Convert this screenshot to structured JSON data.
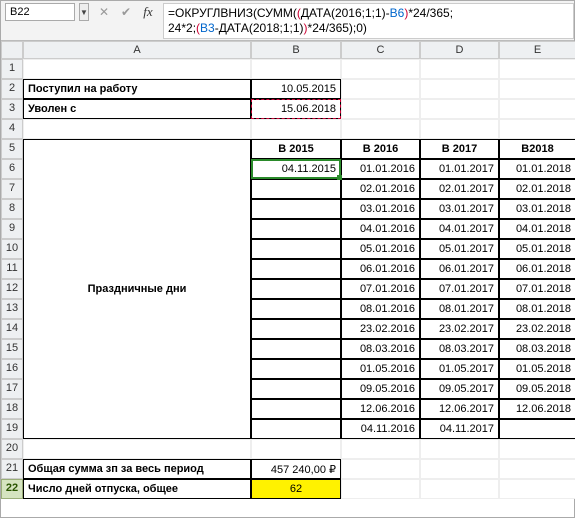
{
  "nameBox": "B22",
  "formula": {
    "part1": "=ОКРУГЛВНИЗ(СУММ(",
    "paren1": "(",
    "part2": "ДАТА(2016;1;1)-",
    "ref1": "B6",
    "paren1b": ")",
    "part3": "*24/365;",
    "break": "\n",
    "part4": "24*2;",
    "paren2": "(",
    "ref2": "B3",
    "part5": "-ДАТА(2018;1;1)",
    "paren2b": ")",
    "part6": "*24/365);0)"
  },
  "colHeaders": [
    "A",
    "B",
    "C",
    "D",
    "E"
  ],
  "rowNumbers": [
    "1",
    "2",
    "3",
    "4",
    "5",
    "6",
    "7",
    "8",
    "9",
    "10",
    "11",
    "12",
    "13",
    "14",
    "15",
    "16",
    "17",
    "18",
    "19",
    "20",
    "21",
    "22"
  ],
  "labels": {
    "startWork": "Поступил на работу",
    "fired": "Уволен с",
    "holidays": "Праздничные дни",
    "totalSum": "Общая сумма зп за весь период",
    "vacationDays": "Число дней отпуска, общее"
  },
  "values": {
    "startDate": "10.05.2015",
    "fireDate": "15.06.2018",
    "totalSum": "457 240,00 ₽",
    "vacationDays": "62"
  },
  "yearHeaders": [
    "В 2015",
    "В 2016",
    "В 2017",
    "В2018"
  ],
  "holidayTable": [
    [
      "04.11.2015",
      "01.01.2016",
      "01.01.2017",
      "01.01.2018"
    ],
    [
      "",
      "02.01.2016",
      "02.01.2017",
      "02.01.2018"
    ],
    [
      "",
      "03.01.2016",
      "03.01.2017",
      "03.01.2018"
    ],
    [
      "",
      "04.01.2016",
      "04.01.2017",
      "04.01.2018"
    ],
    [
      "",
      "05.01.2016",
      "05.01.2017",
      "05.01.2018"
    ],
    [
      "",
      "06.01.2016",
      "06.01.2017",
      "06.01.2018"
    ],
    [
      "",
      "07.01.2016",
      "07.01.2017",
      "07.01.2018"
    ],
    [
      "",
      "08.01.2016",
      "08.01.2017",
      "08.01.2018"
    ],
    [
      "",
      "23.02.2016",
      "23.02.2017",
      "23.02.2018"
    ],
    [
      "",
      "08.03.2016",
      "08.03.2017",
      "08.03.2018"
    ],
    [
      "",
      "01.05.2016",
      "01.05.2017",
      "01.05.2018"
    ],
    [
      "",
      "09.05.2016",
      "09.05.2017",
      "09.05.2018"
    ],
    [
      "",
      "12.06.2016",
      "12.06.2017",
      "12.06.2018"
    ],
    [
      "",
      "04.11.2016",
      "04.11.2017",
      ""
    ]
  ]
}
